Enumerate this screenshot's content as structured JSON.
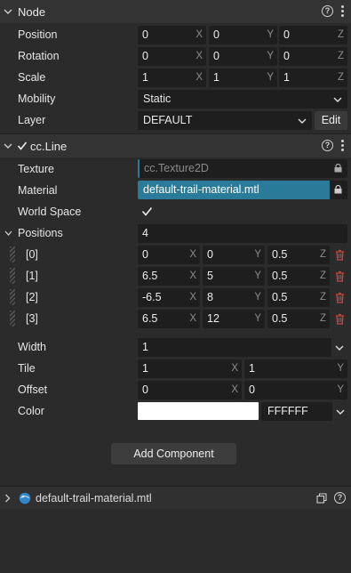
{
  "node": {
    "title": "Node",
    "position": {
      "label": "Position",
      "x": "0",
      "y": "0",
      "z": "0"
    },
    "rotation": {
      "label": "Rotation",
      "x": "0",
      "y": "0",
      "z": "0"
    },
    "scale": {
      "label": "Scale",
      "x": "1",
      "y": "1",
      "z": "1"
    },
    "mobility": {
      "label": "Mobility",
      "value": "Static"
    },
    "layer": {
      "label": "Layer",
      "value": "DEFAULT",
      "edit_label": "Edit"
    }
  },
  "axes": {
    "x": "X",
    "y": "Y",
    "z": "Z"
  },
  "line": {
    "title": "cc.Line",
    "enabled": true,
    "texture": {
      "label": "Texture",
      "value": "cc.Texture2D"
    },
    "material": {
      "label": "Material",
      "value": "default-trail-material.mtl"
    },
    "world_space": {
      "label": "World Space",
      "checked": true
    },
    "positions": {
      "label": "Positions",
      "count": "4",
      "items": [
        {
          "index": "[0]",
          "x": "0",
          "y": "0",
          "z": "0.5"
        },
        {
          "index": "[1]",
          "x": "6.5",
          "y": "5",
          "z": "0.5"
        },
        {
          "index": "[2]",
          "x": "-6.5",
          "y": "8",
          "z": "0.5"
        },
        {
          "index": "[3]",
          "x": "6.5",
          "y": "12",
          "z": "0.5"
        }
      ]
    },
    "width": {
      "label": "Width",
      "value": "1"
    },
    "tile": {
      "label": "Tile",
      "x": "1",
      "y": "1"
    },
    "offset": {
      "label": "Offset",
      "x": "0",
      "y": "0"
    },
    "color": {
      "label": "Color",
      "hex": "FFFFFF",
      "swatch": "#ffffff"
    }
  },
  "add_component_label": "Add Component",
  "footer": {
    "asset_name": "default-trail-material.mtl"
  },
  "icons": [
    "chevron-down-icon",
    "help-icon",
    "kebab-icon",
    "checkbox-icon",
    "lock-icon",
    "trash-icon",
    "material-sphere-icon",
    "chevron-right-icon",
    "copy-icon"
  ],
  "colors": {
    "panel": "#2b2b2b",
    "header": "#333333",
    "field": "#1e1e1e",
    "accent": "#2a7a9a",
    "danger": "#c0392b"
  }
}
